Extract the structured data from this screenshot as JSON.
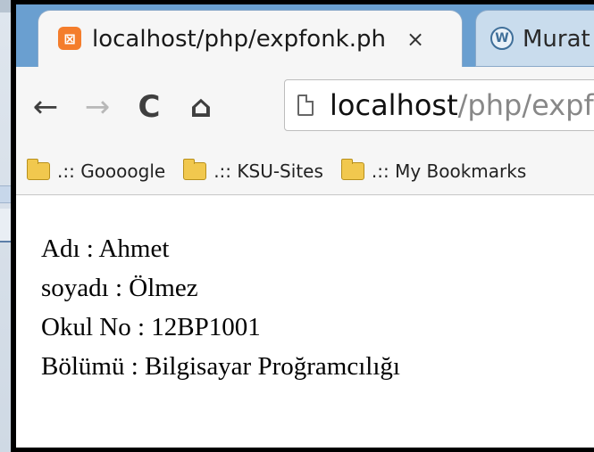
{
  "tabs": [
    {
      "title": "localhost/php/expfonk.ph",
      "close": "×",
      "active": true
    },
    {
      "title": "Murat",
      "active": false
    }
  ],
  "toolbar": {
    "back": "←",
    "forward": "→",
    "reload": "C",
    "home": "⌂"
  },
  "address": {
    "host": "localhost",
    "path": "/php/expfonk.php"
  },
  "bookmarks": [
    {
      "label": ".:: Goooogle"
    },
    {
      "label": ".:: KSU-Sites"
    },
    {
      "label": ".:: My Bookmarks"
    }
  ],
  "content": {
    "lines": [
      "Adı : Ahmet",
      "soyadı : Ölmez",
      "Okul No : 12BP1001",
      "Bölümü : Bilgisayar Proğramcılığı"
    ]
  }
}
